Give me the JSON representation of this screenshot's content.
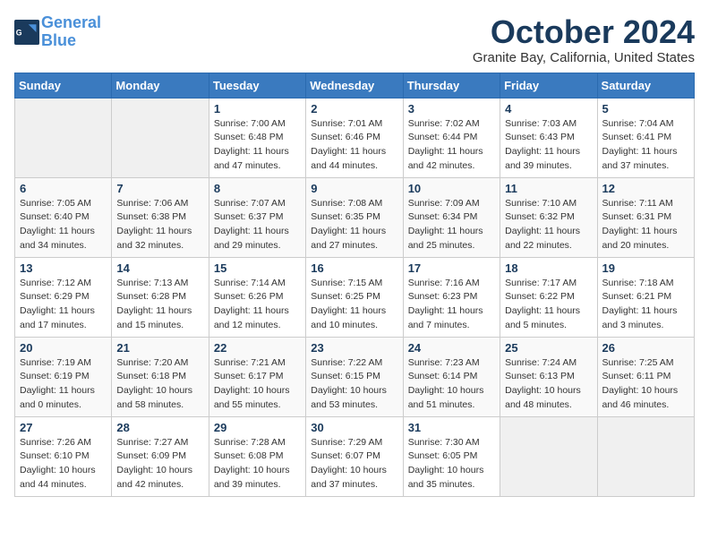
{
  "logo": {
    "text_general": "General",
    "text_blue": "Blue"
  },
  "header": {
    "month": "October 2024",
    "location": "Granite Bay, California, United States"
  },
  "days_of_week": [
    "Sunday",
    "Monday",
    "Tuesday",
    "Wednesday",
    "Thursday",
    "Friday",
    "Saturday"
  ],
  "weeks": [
    [
      {
        "day": "",
        "sunrise": "",
        "sunset": "",
        "daylight": ""
      },
      {
        "day": "",
        "sunrise": "",
        "sunset": "",
        "daylight": ""
      },
      {
        "day": "1",
        "sunrise": "Sunrise: 7:00 AM",
        "sunset": "Sunset: 6:48 PM",
        "daylight": "Daylight: 11 hours and 47 minutes."
      },
      {
        "day": "2",
        "sunrise": "Sunrise: 7:01 AM",
        "sunset": "Sunset: 6:46 PM",
        "daylight": "Daylight: 11 hours and 44 minutes."
      },
      {
        "day": "3",
        "sunrise": "Sunrise: 7:02 AM",
        "sunset": "Sunset: 6:44 PM",
        "daylight": "Daylight: 11 hours and 42 minutes."
      },
      {
        "day": "4",
        "sunrise": "Sunrise: 7:03 AM",
        "sunset": "Sunset: 6:43 PM",
        "daylight": "Daylight: 11 hours and 39 minutes."
      },
      {
        "day": "5",
        "sunrise": "Sunrise: 7:04 AM",
        "sunset": "Sunset: 6:41 PM",
        "daylight": "Daylight: 11 hours and 37 minutes."
      }
    ],
    [
      {
        "day": "6",
        "sunrise": "Sunrise: 7:05 AM",
        "sunset": "Sunset: 6:40 PM",
        "daylight": "Daylight: 11 hours and 34 minutes."
      },
      {
        "day": "7",
        "sunrise": "Sunrise: 7:06 AM",
        "sunset": "Sunset: 6:38 PM",
        "daylight": "Daylight: 11 hours and 32 minutes."
      },
      {
        "day": "8",
        "sunrise": "Sunrise: 7:07 AM",
        "sunset": "Sunset: 6:37 PM",
        "daylight": "Daylight: 11 hours and 29 minutes."
      },
      {
        "day": "9",
        "sunrise": "Sunrise: 7:08 AM",
        "sunset": "Sunset: 6:35 PM",
        "daylight": "Daylight: 11 hours and 27 minutes."
      },
      {
        "day": "10",
        "sunrise": "Sunrise: 7:09 AM",
        "sunset": "Sunset: 6:34 PM",
        "daylight": "Daylight: 11 hours and 25 minutes."
      },
      {
        "day": "11",
        "sunrise": "Sunrise: 7:10 AM",
        "sunset": "Sunset: 6:32 PM",
        "daylight": "Daylight: 11 hours and 22 minutes."
      },
      {
        "day": "12",
        "sunrise": "Sunrise: 7:11 AM",
        "sunset": "Sunset: 6:31 PM",
        "daylight": "Daylight: 11 hours and 20 minutes."
      }
    ],
    [
      {
        "day": "13",
        "sunrise": "Sunrise: 7:12 AM",
        "sunset": "Sunset: 6:29 PM",
        "daylight": "Daylight: 11 hours and 17 minutes."
      },
      {
        "day": "14",
        "sunrise": "Sunrise: 7:13 AM",
        "sunset": "Sunset: 6:28 PM",
        "daylight": "Daylight: 11 hours and 15 minutes."
      },
      {
        "day": "15",
        "sunrise": "Sunrise: 7:14 AM",
        "sunset": "Sunset: 6:26 PM",
        "daylight": "Daylight: 11 hours and 12 minutes."
      },
      {
        "day": "16",
        "sunrise": "Sunrise: 7:15 AM",
        "sunset": "Sunset: 6:25 PM",
        "daylight": "Daylight: 11 hours and 10 minutes."
      },
      {
        "day": "17",
        "sunrise": "Sunrise: 7:16 AM",
        "sunset": "Sunset: 6:23 PM",
        "daylight": "Daylight: 11 hours and 7 minutes."
      },
      {
        "day": "18",
        "sunrise": "Sunrise: 7:17 AM",
        "sunset": "Sunset: 6:22 PM",
        "daylight": "Daylight: 11 hours and 5 minutes."
      },
      {
        "day": "19",
        "sunrise": "Sunrise: 7:18 AM",
        "sunset": "Sunset: 6:21 PM",
        "daylight": "Daylight: 11 hours and 3 minutes."
      }
    ],
    [
      {
        "day": "20",
        "sunrise": "Sunrise: 7:19 AM",
        "sunset": "Sunset: 6:19 PM",
        "daylight": "Daylight: 11 hours and 0 minutes."
      },
      {
        "day": "21",
        "sunrise": "Sunrise: 7:20 AM",
        "sunset": "Sunset: 6:18 PM",
        "daylight": "Daylight: 10 hours and 58 minutes."
      },
      {
        "day": "22",
        "sunrise": "Sunrise: 7:21 AM",
        "sunset": "Sunset: 6:17 PM",
        "daylight": "Daylight: 10 hours and 55 minutes."
      },
      {
        "day": "23",
        "sunrise": "Sunrise: 7:22 AM",
        "sunset": "Sunset: 6:15 PM",
        "daylight": "Daylight: 10 hours and 53 minutes."
      },
      {
        "day": "24",
        "sunrise": "Sunrise: 7:23 AM",
        "sunset": "Sunset: 6:14 PM",
        "daylight": "Daylight: 10 hours and 51 minutes."
      },
      {
        "day": "25",
        "sunrise": "Sunrise: 7:24 AM",
        "sunset": "Sunset: 6:13 PM",
        "daylight": "Daylight: 10 hours and 48 minutes."
      },
      {
        "day": "26",
        "sunrise": "Sunrise: 7:25 AM",
        "sunset": "Sunset: 6:11 PM",
        "daylight": "Daylight: 10 hours and 46 minutes."
      }
    ],
    [
      {
        "day": "27",
        "sunrise": "Sunrise: 7:26 AM",
        "sunset": "Sunset: 6:10 PM",
        "daylight": "Daylight: 10 hours and 44 minutes."
      },
      {
        "day": "28",
        "sunrise": "Sunrise: 7:27 AM",
        "sunset": "Sunset: 6:09 PM",
        "daylight": "Daylight: 10 hours and 42 minutes."
      },
      {
        "day": "29",
        "sunrise": "Sunrise: 7:28 AM",
        "sunset": "Sunset: 6:08 PM",
        "daylight": "Daylight: 10 hours and 39 minutes."
      },
      {
        "day": "30",
        "sunrise": "Sunrise: 7:29 AM",
        "sunset": "Sunset: 6:07 PM",
        "daylight": "Daylight: 10 hours and 37 minutes."
      },
      {
        "day": "31",
        "sunrise": "Sunrise: 7:30 AM",
        "sunset": "Sunset: 6:05 PM",
        "daylight": "Daylight: 10 hours and 35 minutes."
      },
      {
        "day": "",
        "sunrise": "",
        "sunset": "",
        "daylight": ""
      },
      {
        "day": "",
        "sunrise": "",
        "sunset": "",
        "daylight": ""
      }
    ]
  ]
}
